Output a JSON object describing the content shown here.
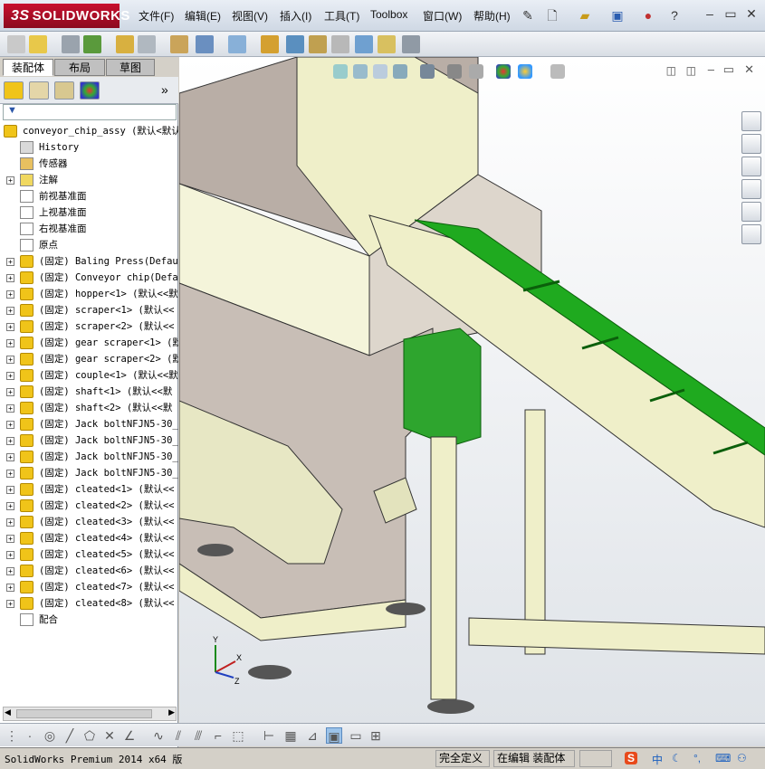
{
  "app": {
    "logo_text": "SOLIDWORKS",
    "logo_prefix": "3S"
  },
  "menu": [
    "文件(F)",
    "编辑(E)",
    "视图(V)",
    "插入(I)",
    "工具(T)",
    "Toolbox",
    "窗口(W)",
    "帮助(H)"
  ],
  "tabs": [
    "装配体",
    "布局",
    "草图"
  ],
  "filter_symbol": "▼",
  "tree": {
    "root": "conveyor_chip_assy  (默认<默认",
    "items": [
      {
        "label": "History",
        "icon": "history-icon",
        "expandable": false
      },
      {
        "label": "传感器",
        "icon": "sensor-icon",
        "expandable": false
      },
      {
        "label": "注解",
        "icon": "annotation-icon",
        "expandable": true
      },
      {
        "label": "前视基准面",
        "icon": "plane-icon",
        "expandable": false
      },
      {
        "label": "上视基准面",
        "icon": "plane-icon",
        "expandable": false
      },
      {
        "label": "右视基准面",
        "icon": "plane-icon",
        "expandable": false
      },
      {
        "label": "原点",
        "icon": "origin-icon",
        "expandable": false
      },
      {
        "label": "(固定) Baling Press(Defau",
        "icon": "part-icon",
        "expandable": true
      },
      {
        "label": "(固定) Conveyor chip(Defau",
        "icon": "part-icon",
        "expandable": true
      },
      {
        "label": "(固定) hopper<1> (默认<<默",
        "icon": "part-icon",
        "expandable": true
      },
      {
        "label": "(固定) scraper<1> (默认<<",
        "icon": "part-icon",
        "expandable": true
      },
      {
        "label": "(固定) scraper<2> (默认<<",
        "icon": "part-icon",
        "expandable": true
      },
      {
        "label": "(固定) gear scraper<1> (默",
        "icon": "part-icon",
        "expandable": true
      },
      {
        "label": "(固定) gear scraper<2> (默",
        "icon": "part-icon",
        "expandable": true
      },
      {
        "label": "(固定) couple<1> (默认<<默",
        "icon": "part-icon",
        "expandable": true
      },
      {
        "label": "(固定) shaft<1> (默认<<默",
        "icon": "part-icon",
        "expandable": true
      },
      {
        "label": "(固定) shaft<2> (默认<<默",
        "icon": "part-icon",
        "expandable": true
      },
      {
        "label": "(固定) Jack boltNFJN5-30_",
        "icon": "part-icon",
        "expandable": true
      },
      {
        "label": "(固定) Jack boltNFJN5-30_",
        "icon": "part-icon",
        "expandable": true
      },
      {
        "label": "(固定) Jack boltNFJN5-30_",
        "icon": "part-icon",
        "expandable": true
      },
      {
        "label": "(固定) Jack boltNFJN5-30_",
        "icon": "part-icon",
        "expandable": true
      },
      {
        "label": "(固定) cleated<1> (默认<<",
        "icon": "part-icon",
        "expandable": true
      },
      {
        "label": "(固定) cleated<2> (默认<<",
        "icon": "part-icon",
        "expandable": true
      },
      {
        "label": "(固定) cleated<3> (默认<<",
        "icon": "part-icon",
        "expandable": true
      },
      {
        "label": "(固定) cleated<4> (默认<<",
        "icon": "part-icon",
        "expandable": true
      },
      {
        "label": "(固定) cleated<5> (默认<<",
        "icon": "part-icon",
        "expandable": true
      },
      {
        "label": "(固定) cleated<6> (默认<<",
        "icon": "part-icon",
        "expandable": true
      },
      {
        "label": "(固定) cleated<7> (默认<<",
        "icon": "part-icon",
        "expandable": true
      },
      {
        "label": "(固定) cleated<8> (默认<<",
        "icon": "part-icon",
        "expandable": true
      },
      {
        "label": "配合",
        "icon": "mates-icon",
        "expandable": false
      }
    ]
  },
  "triad": {
    "x": "X",
    "y": "Y",
    "z": "Z"
  },
  "status": {
    "product": "SolidWorks Premium 2014 x64 版",
    "definition": "完全定义",
    "mode": "在编辑 装配体",
    "tray_text": "中"
  },
  "colors": {
    "conveyor_green": "#1faa1f",
    "frame_cream": "#efefc9",
    "hopper_taupe": "#b9aea6",
    "logo_red": "#c8102e"
  }
}
